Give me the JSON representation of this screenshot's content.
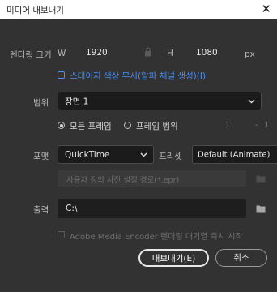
{
  "window": {
    "title": "미디어 내보내기"
  },
  "render_size": {
    "label": "렌더링 크기",
    "width_label": "W",
    "width_value": "1920",
    "height_label": "H",
    "height_value": "1080",
    "unit": "px"
  },
  "ignore_stage_color": {
    "label": "스테이지 색상 무시(알파 채널 생성)(I)"
  },
  "range": {
    "label": "범위",
    "selected": "장면 1",
    "all_frames_label": "모든 프레임",
    "frame_range_label": "프레임 범위",
    "from": "1",
    "separator": "-",
    "to": "1"
  },
  "format": {
    "label": "포맷",
    "selected": "QuickTime",
    "preset_label": "프리셋",
    "preset_selected": "Default (Animate)",
    "preset_path_placeholder": "사용자 정의 사전 설정 경로(*.epr)"
  },
  "output": {
    "label": "출력",
    "path": "C:\\"
  },
  "encoder_option": {
    "label": "Adobe Media Encoder 렌더링 대기열 즉시 시작"
  },
  "buttons": {
    "export": "내보내기(E)",
    "cancel": "취소"
  },
  "colors": {
    "accent": "#4a8ff0",
    "background": "#323232"
  }
}
